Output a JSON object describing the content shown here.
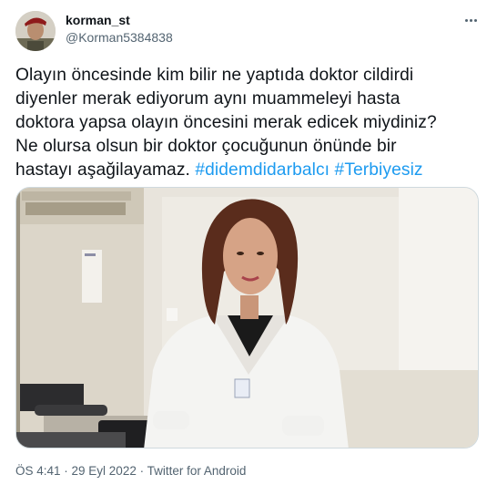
{
  "user": {
    "display_name": "korman_st",
    "handle": "@Korman5384838"
  },
  "tweet": {
    "lines": [
      "Olayın öncesinde kim bilir ne yaptıda doktor cildirdi",
      "diyenler merak ediyorum  aynı muammeleyi hasta",
      "doktora yapsa olayın öncesini merak edicek miydiniz?",
      "Ne olursa olsun bir doktor çocuğunun önünde bir"
    ],
    "last_line_text": "hastayı aşağilayamaz. ",
    "hashtags": [
      "#didemdidarbalcı",
      "#Terbiyesiz"
    ]
  },
  "meta": {
    "time": "ÖS 4:41",
    "separator": " · ",
    "date": "29 Eyl 2022",
    "source": "Twitter for Android"
  },
  "icons": {
    "more": "more-horizontal-icon"
  },
  "colors": {
    "link": "#1d9bf0",
    "secondary_text": "#536471",
    "primary_text": "#0f1419"
  }
}
